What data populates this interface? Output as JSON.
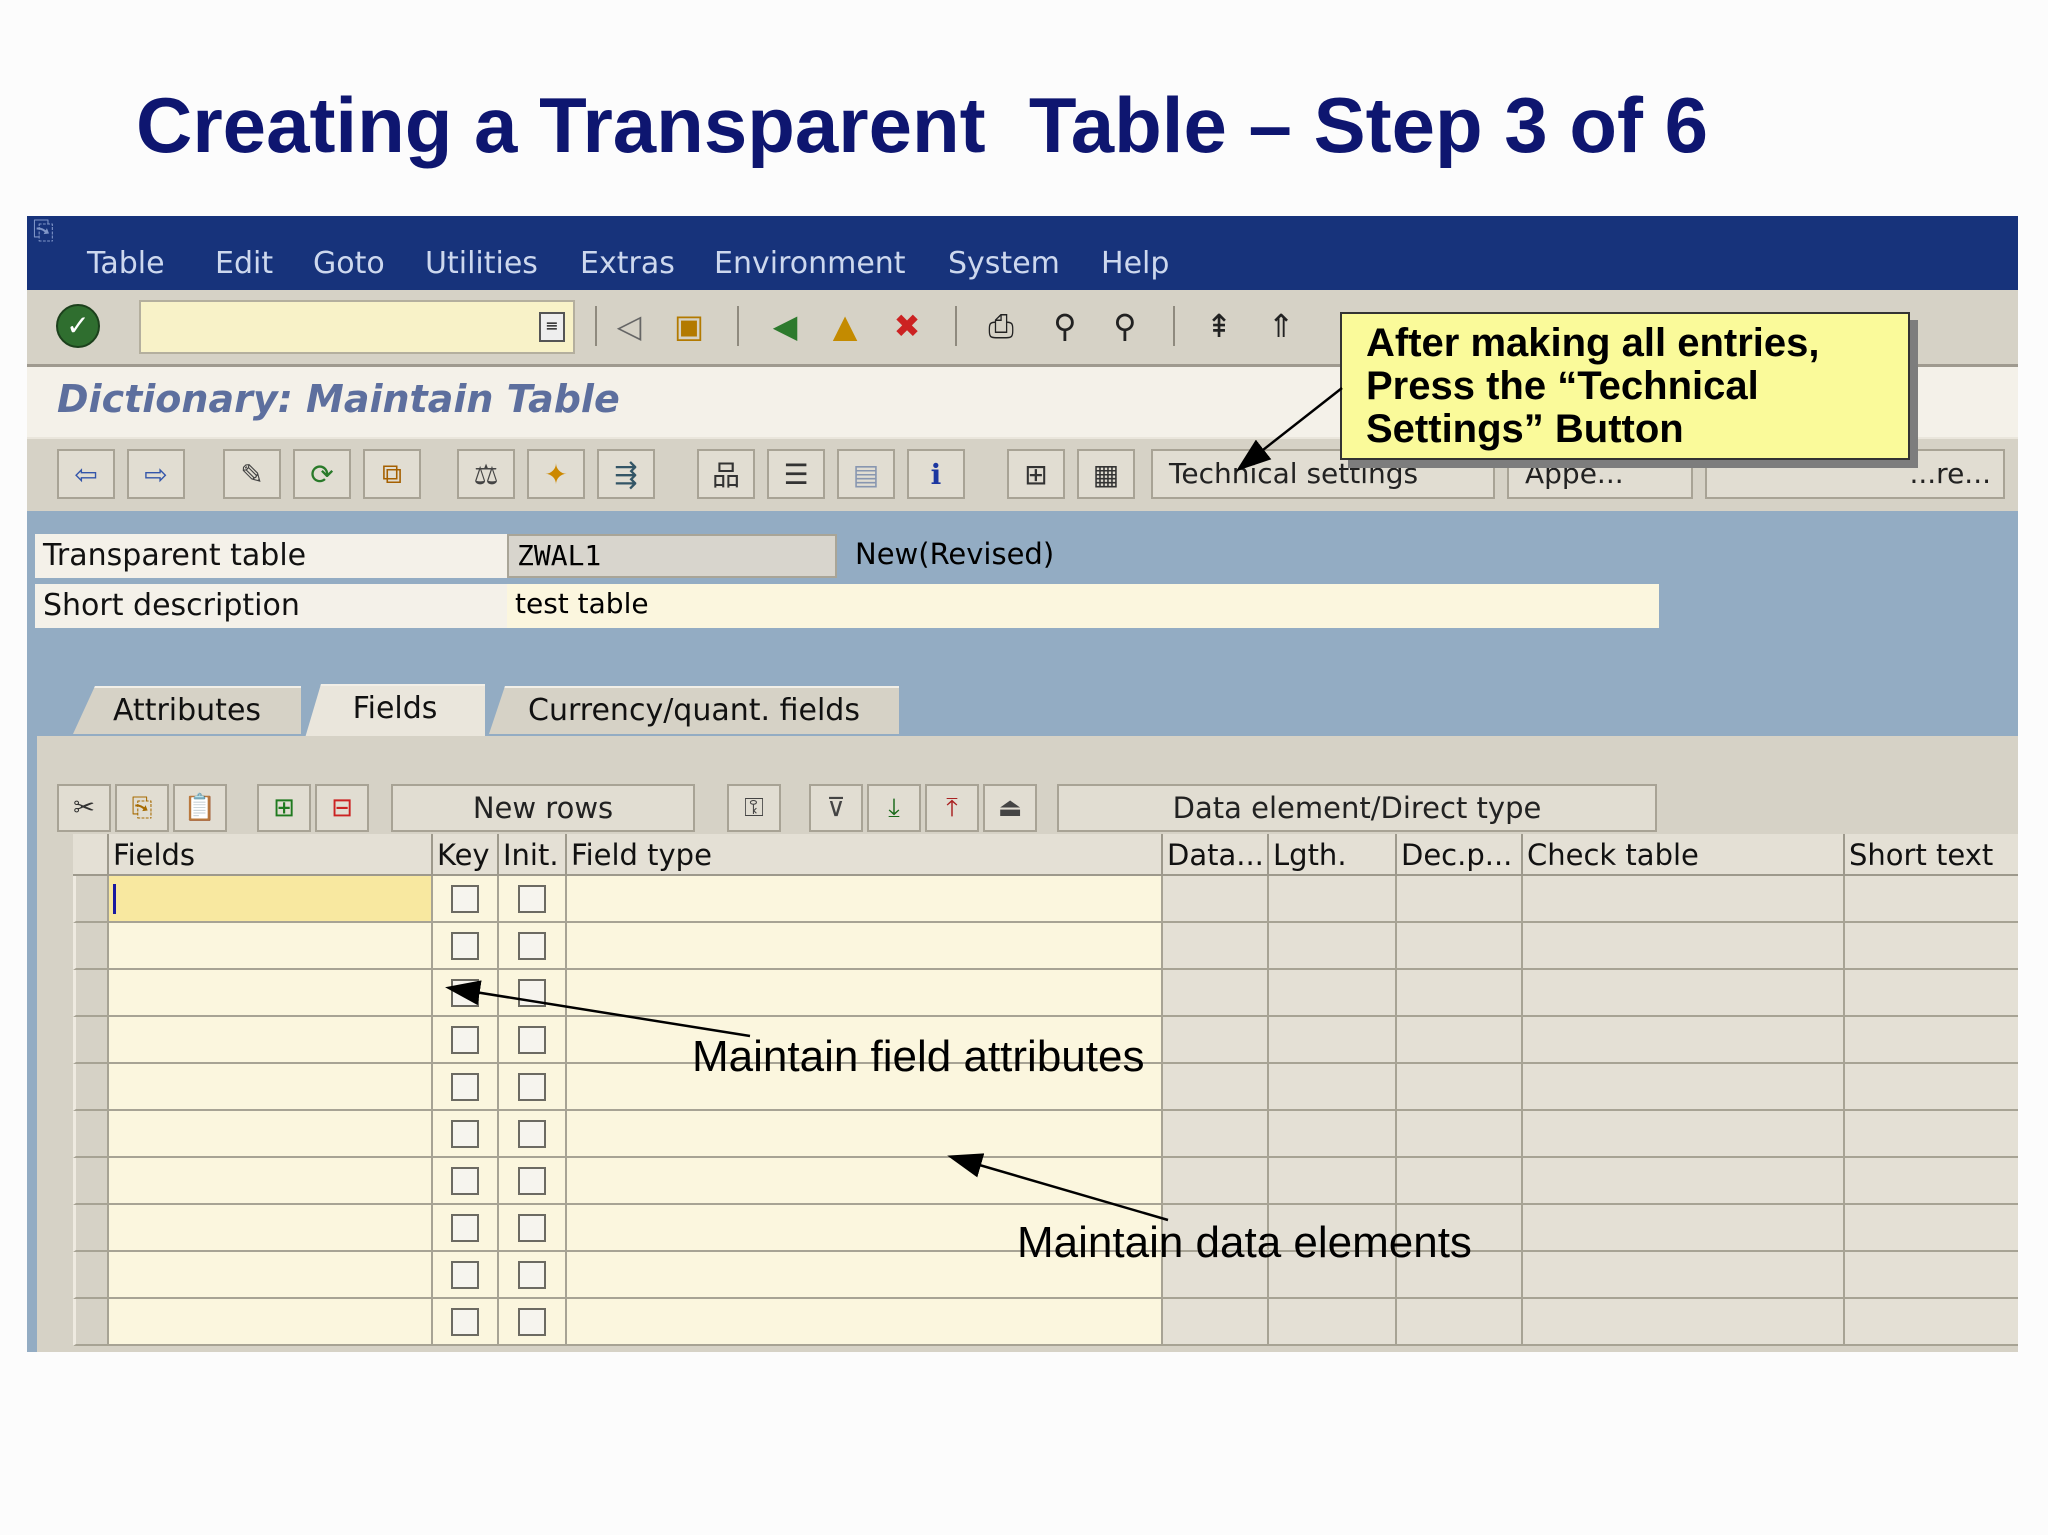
{
  "slide_title": "Creating a Transparent  Table – Step 3 of 6",
  "menu": [
    "Table",
    "Edit",
    "Goto",
    "Utilities",
    "Extras",
    "Environment",
    "System",
    "Help"
  ],
  "screen_title": "Dictionary: Maintain Table",
  "toolbar": {
    "technical_settings_label": "Technical settings",
    "hidden_btn_3_label": "Appe...",
    "hidden_btn_4_label": "...re..."
  },
  "header": {
    "table_label": "Transparent table",
    "table_value": "ZWAL1",
    "status": "New(Revised)",
    "short_desc_label": "Short description",
    "short_desc_value": "test table"
  },
  "tabs": [
    "Attributes",
    "Fields",
    "Currency/quant. fields"
  ],
  "active_tab": "Fields",
  "table_toolbar": {
    "new_rows_label": "New rows",
    "data_element_label": "Data element/Direct type"
  },
  "columns": [
    "Fields",
    "Key",
    "Init.",
    "Field type",
    "Data...",
    "Lgth.",
    "Dec.p...",
    "Check table",
    "Short text"
  ],
  "row_count": 10,
  "callout": [
    "After making all entries,",
    "Press the “Technical",
    "Settings” Button"
  ],
  "annotations": {
    "field_attributes": "Maintain field attributes",
    "data_elements": "Maintain data elements"
  },
  "colors": {
    "title": "#0e1670",
    "menubar": "#17337b",
    "screen_bg": "#93acc3",
    "callout_bg": "#fafa9a"
  }
}
